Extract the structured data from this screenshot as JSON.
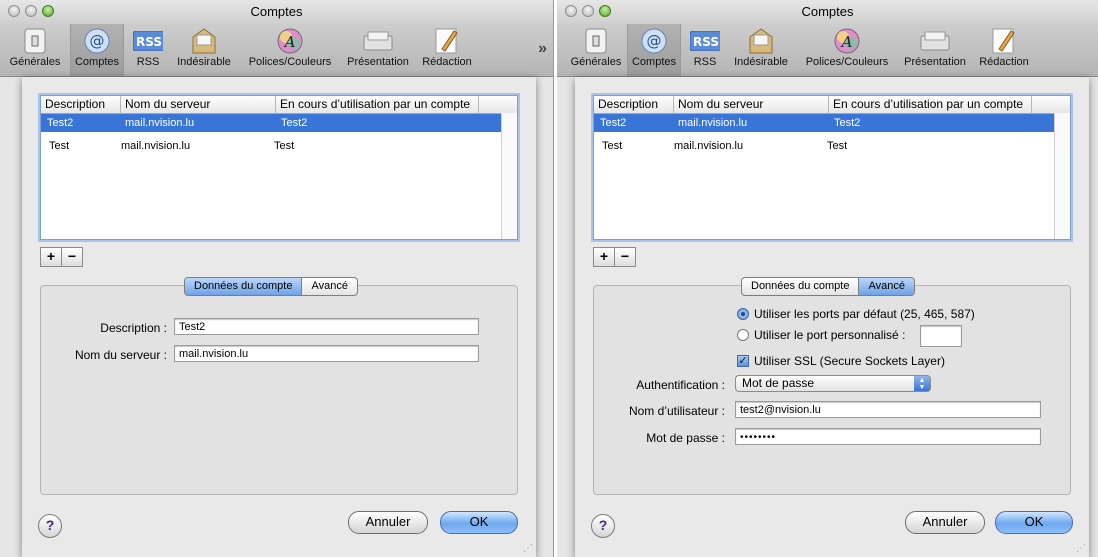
{
  "windows": [
    {
      "title": "Comptes",
      "toolbar": [
        "Générales",
        "Comptes",
        "RSS",
        "Indésirable",
        "Polices/Couleurs",
        "Présentation",
        "Rédaction"
      ],
      "toolbar_overflow": "»",
      "table": {
        "headers": [
          "Description",
          "Nom du serveur",
          "En cours d’utilisation par un compte"
        ],
        "rows": [
          {
            "description": "Test2",
            "server": "mail.nvision.lu",
            "in_use": "Test2"
          },
          {
            "description": "Test",
            "server": "mail.nvision.lu",
            "in_use": "Test"
          }
        ]
      },
      "add_label": "+",
      "remove_label": "−",
      "tabs": [
        "Données du compte",
        "Avancé"
      ],
      "active_tab": 0,
      "form": {
        "description_label": "Description :",
        "description_value": "Test2",
        "server_label": "Nom du serveur :",
        "server_value": "mail.nvision.lu"
      },
      "help_label": "?",
      "cancel_label": "Annuler",
      "ok_label": "OK"
    },
    {
      "title": "Comptes",
      "toolbar": [
        "Générales",
        "Comptes",
        "RSS",
        "Indésirable",
        "Polices/Couleurs",
        "Présentation",
        "Rédaction"
      ],
      "table": {
        "headers": [
          "Description",
          "Nom du serveur",
          "En cours d’utilisation par un compte"
        ],
        "rows": [
          {
            "description": "Test2",
            "server": "mail.nvision.lu",
            "in_use": "Test2"
          },
          {
            "description": "Test",
            "server": "mail.nvision.lu",
            "in_use": "Test"
          }
        ]
      },
      "add_label": "+",
      "remove_label": "−",
      "tabs": [
        "Données du compte",
        "Avancé"
      ],
      "active_tab": 1,
      "form": {
        "default_ports_label": "Utiliser les ports par défaut (25, 465, 587)",
        "custom_port_label": "Utiliser le port personnalisé :",
        "custom_port_value": "",
        "ssl_label": "Utiliser SSL (Secure Sockets Layer)",
        "ssl_checked": true,
        "auth_label": "Authentification :",
        "auth_value": "Mot de passe",
        "user_label": "Nom d’utilisateur :",
        "user_value": "test2@nvision.lu",
        "password_label": "Mot de passe :",
        "password_value": "••••••••"
      },
      "help_label": "?",
      "cancel_label": "Annuler",
      "ok_label": "OK"
    }
  ],
  "colors": {
    "selection": "#3875d7",
    "ok_button": "#6ea8ee",
    "toolbar": "#bdbdbd"
  }
}
